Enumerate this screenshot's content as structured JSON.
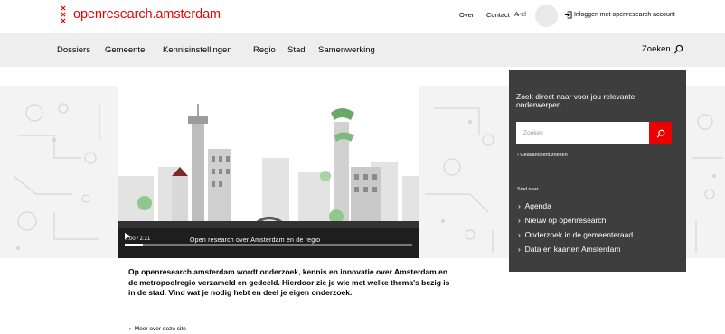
{
  "header": {
    "brand": "openresearch.amsterdam",
    "nav": [
      {
        "label": "Over"
      },
      {
        "label": "Contact"
      }
    ],
    "translate": "A̷ el",
    "login_label": "Inloggen met openresearch account"
  },
  "nav": {
    "items": [
      {
        "label": "Dossiers"
      },
      {
        "label": "Gemeente"
      },
      {
        "label": "Kennisinstellingen"
      },
      {
        "label": "Regio"
      },
      {
        "label": "Stad"
      },
      {
        "label": "Samenwerking"
      }
    ],
    "search_label": "Zoeken"
  },
  "video": {
    "time": "0:00 / 2:21",
    "caption": "Open research over Amsterdam en de regio"
  },
  "panel": {
    "title": "Zoek direct naar voor jou relevante onderwerpen",
    "search_placeholder": "Zoeken",
    "advanced_link": "Geavanceerd zoeken",
    "quick_label": "Snel naar",
    "quick_links": [
      {
        "label": "Agenda"
      },
      {
        "label": "Nieuw op openresearch"
      },
      {
        "label": "Onderzoek in de gemeenteraad"
      },
      {
        "label": "Data en kaarten Amsterdam"
      }
    ]
  },
  "intro": {
    "text": "Op openresearch.amsterdam wordt onderzoek, kennis en innovatie over Amsterdam en de metropoolregio verzameld en gedeeld. Hierdoor zie je wie met welke thema's bezig is in de stad. Vind wat je nodig hebt en deel je eigen onderzoek.",
    "more_link": "Meer over deze site"
  },
  "colors": {
    "brand_red": "#ec0000",
    "panel_bg": "#3e3e3e",
    "nav_bg": "#eeeeee"
  }
}
